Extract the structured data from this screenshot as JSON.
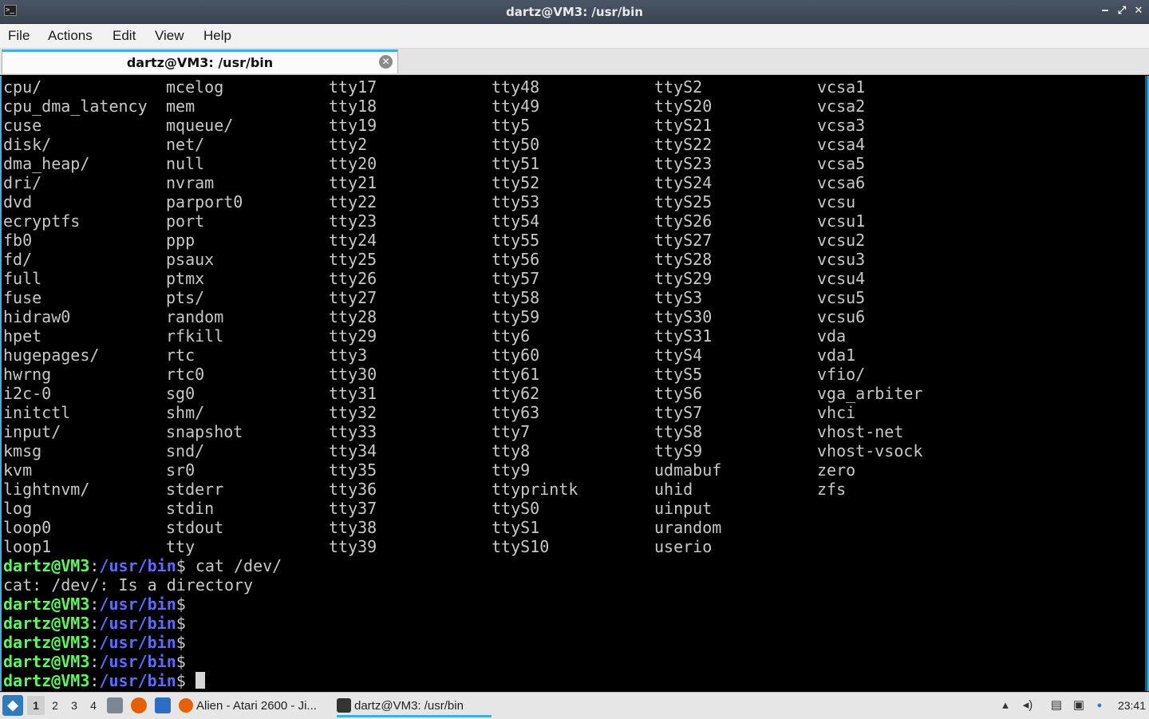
{
  "window": {
    "title": "dartz@VM3: /usr/bin",
    "icon": "terminal-icon",
    "controls": {
      "minimize": "‒",
      "maximize": "⤢",
      "close": "✕"
    }
  },
  "menu": [
    "File",
    "Actions",
    "Edit",
    "View",
    "Help"
  ],
  "tab": {
    "label": "dartz@VM3: /usr/bin",
    "close_icon": "close-icon"
  },
  "terminal": {
    "listing": [
      [
        "cpu/",
        "mcelog",
        "tty17",
        "tty48",
        "ttyS2",
        "vcsa1"
      ],
      [
        "cpu_dma_latency",
        "mem",
        "tty18",
        "tty49",
        "ttyS20",
        "vcsa2"
      ],
      [
        "cuse",
        "mqueue/",
        "tty19",
        "tty5",
        "ttyS21",
        "vcsa3"
      ],
      [
        "disk/",
        "net/",
        "tty2",
        "tty50",
        "ttyS22",
        "vcsa4"
      ],
      [
        "dma_heap/",
        "null",
        "tty20",
        "tty51",
        "ttyS23",
        "vcsa5"
      ],
      [
        "dri/",
        "nvram",
        "tty21",
        "tty52",
        "ttyS24",
        "vcsa6"
      ],
      [
        "dvd",
        "parport0",
        "tty22",
        "tty53",
        "ttyS25",
        "vcsu"
      ],
      [
        "ecryptfs",
        "port",
        "tty23",
        "tty54",
        "ttyS26",
        "vcsu1"
      ],
      [
        "fb0",
        "ppp",
        "tty24",
        "tty55",
        "ttyS27",
        "vcsu2"
      ],
      [
        "fd/",
        "psaux",
        "tty25",
        "tty56",
        "ttyS28",
        "vcsu3"
      ],
      [
        "full",
        "ptmx",
        "tty26",
        "tty57",
        "ttyS29",
        "vcsu4"
      ],
      [
        "fuse",
        "pts/",
        "tty27",
        "tty58",
        "ttyS3",
        "vcsu5"
      ],
      [
        "hidraw0",
        "random",
        "tty28",
        "tty59",
        "ttyS30",
        "vcsu6"
      ],
      [
        "hpet",
        "rfkill",
        "tty29",
        "tty6",
        "ttyS31",
        "vda"
      ],
      [
        "hugepages/",
        "rtc",
        "tty3",
        "tty60",
        "ttyS4",
        "vda1"
      ],
      [
        "hwrng",
        "rtc0",
        "tty30",
        "tty61",
        "ttyS5",
        "vfio/"
      ],
      [
        "i2c-0",
        "sg0",
        "tty31",
        "tty62",
        "ttyS6",
        "vga_arbiter"
      ],
      [
        "initctl",
        "shm/",
        "tty32",
        "tty63",
        "ttyS7",
        "vhci"
      ],
      [
        "input/",
        "snapshot",
        "tty33",
        "tty7",
        "ttyS8",
        "vhost-net"
      ],
      [
        "kmsg",
        "snd/",
        "tty34",
        "tty8",
        "ttyS9",
        "vhost-vsock"
      ],
      [
        "kvm",
        "sr0",
        "tty35",
        "tty9",
        "udmabuf",
        "zero"
      ],
      [
        "lightnvm/",
        "stderr",
        "tty36",
        "ttyprintk",
        "uhid",
        "zfs"
      ],
      [
        "log",
        "stdin",
        "tty37",
        "ttyS0",
        "uinput",
        ""
      ],
      [
        "loop0",
        "stdout",
        "tty38",
        "ttyS1",
        "urandom",
        ""
      ],
      [
        "loop1",
        "tty",
        "tty39",
        "ttyS10",
        "userio",
        ""
      ]
    ],
    "prompt": {
      "user": "dartz@VM3",
      "sep": ":",
      "path": "/usr/bin",
      "symbol": "$"
    },
    "history": [
      {
        "type": "prompt",
        "command": " cat /dev/"
      },
      {
        "type": "output",
        "text": "cat: /dev/: Is a directory"
      },
      {
        "type": "prompt",
        "command": ""
      },
      {
        "type": "prompt",
        "command": ""
      },
      {
        "type": "prompt",
        "command": ""
      },
      {
        "type": "prompt",
        "command": ""
      },
      {
        "type": "prompt",
        "command": "",
        "cursor": true
      }
    ]
  },
  "taskbar": {
    "start_icon": "lxqt-menu-icon",
    "workspaces": [
      "1",
      "2",
      "3",
      "4"
    ],
    "active_workspace": "1",
    "launchers": [
      {
        "icon": "file-manager-icon",
        "color": "#7d8794"
      },
      {
        "icon": "firefox-icon",
        "color": "#e66000"
      },
      {
        "icon": "desktop-icon",
        "color": "#2b6fc4"
      }
    ],
    "tasks": [
      {
        "label": "Alien - Atari 2600 - Ji...",
        "icon": "firefox-icon",
        "color": "#e66000",
        "active": false
      },
      {
        "label": "dartz@VM3: /usr/bin",
        "icon": "terminal-icon",
        "color": "#333333",
        "active": true
      }
    ],
    "tray": [
      "network-icon",
      "volume-icon",
      "clipboard-icon",
      "display-icon",
      "notification-icon"
    ],
    "clock": "23:41"
  },
  "colors": {
    "accent": "#3daee9",
    "prompt_user": "#54ff54",
    "prompt_path": "#5c6bff",
    "terminal_fg": "#c8c8c8",
    "terminal_bg": "#000000"
  }
}
